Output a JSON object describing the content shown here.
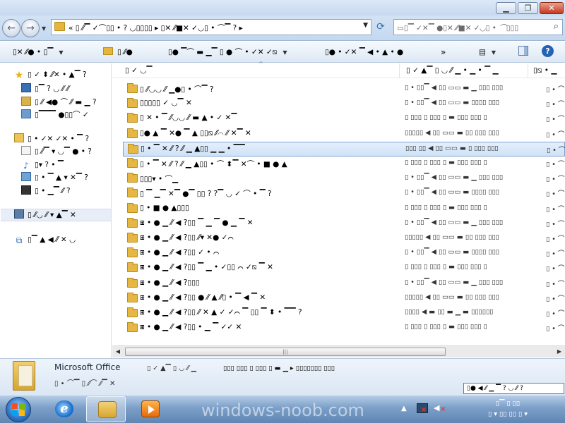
{
  "window": {
    "min_icon": "minimize-icon",
    "max_icon": "maximize-icon",
    "close_icon": "close-icon",
    "min_glyph": "▁",
    "max_glyph": "❐",
    "close_glyph": "✕"
  },
  "address": {
    "path": "« ▯ ⁄⁄▔ ✓⌒▯▯ • ? ◡▯▯▯▯ ▸ ▯✕ ⁄⁄■✕ ✓◡▯ • ⌒▔ ?  ▸",
    "dropdown_glyph": "▼",
    "refresh_glyph": "⟳"
  },
  "search": {
    "placeholder": "▭▯▔ ✓✕▔ ●▯✕ ⁄⁄■✕ ✓◡▯ • ⌒▯▯▯"
  },
  "commands": {
    "organize": "▯✕ ⁄⁄● • ▯▔",
    "include": "▯ ⁄⁄●",
    "share": "▯● ▔⌒ ▬ ▁▔ ▯ ● ⌒ • ✓✕ ✓⧅",
    "burn": "▯● • ✓✕ ▔ ◀ • ▲ • ●",
    "more": "»",
    "views_glyph": "▤",
    "help_glyph": "?"
  },
  "nav": {
    "items": [
      {
        "label": "▯ ✓ ⬍ ⁄⁄✕ • ▲▔ ?",
        "icon": "favorites-star-icon"
      },
      {
        "label": "▯▔ ? ◡ ⁄⁄ ⁄⁄",
        "icon": "desktop-icon"
      },
      {
        "label": "▯ ⁄⁄ ◀● ⌒ ⁄⁄ ▬ ▁ ?",
        "icon": "downloads-icon"
      },
      {
        "label": "▯▔▔▔ ●▯▯⌒ ✓",
        "icon": "recent-places-icon"
      },
      {
        "label": "▯ • ✓✕ ✓✕ • ▔ ?",
        "icon": "libraries-icon"
      },
      {
        "label": "▯ ⁄⁄▔ ▾ ◡▔ ● • ?",
        "icon": "documents-icon"
      },
      {
        "label": "▯▾ ? • ▔",
        "icon": "music-icon"
      },
      {
        "label": "▯ • ▔ ▲ ▾ ✕▔ ?",
        "icon": "pictures-icon"
      },
      {
        "label": "▯ • ▁▔ ⁄⁄ ?",
        "icon": "videos-icon"
      },
      {
        "label": "▯ ⁄⁄◡ ⁄⁄ ▾ ▲▔ ✕",
        "icon": "computer-icon"
      },
      {
        "label": "▯▔ ▲ ◀ ⁄⁄ ✕ ◡",
        "icon": "network-icon"
      }
    ]
  },
  "columns": {
    "name": "▯ ✓ ◡▔",
    "date": "▯ ✓ ▲▔ ▯ ◡ ⁄⁄ ▁ • ▁ • ▔ ▁",
    "type": "▯⧅ • ▁",
    "sort_glyph": "^"
  },
  "files": [
    {
      "name": "▯ ⁄⁄◡◡ ⁄⁄ ▁●▯ • ⌒▔ ?",
      "date": "▯ • ▯▯▔ ◀ ▯▯ ▭▭ ▬ ▁ ▯▯▯ ▯▯▯",
      "type": "▯ • ⌒ ▯▯▯"
    },
    {
      "name": "▯▯▯▯▯ ✓ ◡▔ ✕",
      "date": "▯ • ▯▯▔ ◀ ▯▯ ▭▭ ▬ ▯▯▯▯ ▯▯▯",
      "type": "▯ • ⌒ ▯▯▯"
    },
    {
      "name": "▯ ✕ • ▔ ⁄⁄◡◡ ⁄⁄ ▬ ▲ • ✓ ✕▔",
      "date": "▯ ▯▯▯ ▯ ▯▯▯ ▯ ▬ ▯▯▯ ▯▯▯ ▯",
      "type": "▯ • ⌒ ▯▯▯"
    },
    {
      "name": "▯● ▲ ▔ ✕● ▔ ▲ ▯▯⧅ ⁄⁄⌒ ⁄⁄ ✕▔ ✕",
      "date": "▯▯▯▯▯ ◀ ▯▯ ▭▭ ▬ ▯▯ ▯▯▯ ▯▯▯",
      "type": "▯ • ⌒ ▯▯▯"
    },
    {
      "name": "▯ • ▔ ✕ ⁄⁄ ? ⁄⁄ ▁ ▲▯▯ ▁ ▁ • ▔▔",
      "date": "▯▯▯ ▯▯ ◀ ▯▯ ▭▭ ▬ ▯ ▯▯▯ ▯▯▯",
      "type": "▯ • ⌒ ▯▯▯",
      "selected": true
    },
    {
      "name": "▯ • ▔ ✕ ⁄⁄ ? ⁄⁄ ▁ ▲▯▯ • ⌒ ⬍▔ ✕⌒ • ■ ● ▲",
      "date": "▯ ▯▯▯ ▯ ▯▯▯ ▯ ▬ ▯▯▯ ▯▯▯ ▯",
      "type": "▯ • ⌒ ▯▯▯"
    },
    {
      "name": "▯▯▯▾ • ⌒▁",
      "date": "▯ • ▯▯▔ ◀ ▯▯ ▭▭ ▬ ▁ ▯▯▯ ▯▯▯",
      "type": "▯ • ⌒ ▯▯▯"
    },
    {
      "name": "▯ ▔ ▁▔ ✕▔ ●▔ ▯▯ ? ?▔ ◡ ✓ ⌒ • ▔ ?",
      "date": "▯ • ▯▯▔ ◀ ▯▯ ▭▭ ▬ ▯▯▯▯ ▯▯▯",
      "type": "▯ • ⌒ ▯▯▯"
    },
    {
      "name": "▯ • ■ ● ▲▯▯▯",
      "date": "▯ ▯▯▯ ▯ ▯▯▯ ▯ ▬ ▯▯▯ ▯▯▯ ▯",
      "type": "▯ • ⌒ ▯▯▯"
    },
    {
      "name": "⧆ • ● ▁ ⁄⁄ ◀ ?▯▯ ▔ ▁ ▔ ● ▁ ▔ ✕",
      "date": "▯ • ▯▯▔ ◀ ▯▯ ▭▭ ▬ ▁ ▯▯▯ ▯▯▯",
      "type": "▯ • ⌒ ▯▯▯"
    },
    {
      "name": "⧆ • ● ▁ ⁄⁄ ◀ ?▯▯ ⁄⁄▾ ✕● ✓⌒",
      "date": "▯▯▯▯▯ ◀ ▯▯ ▭▭ ▬ ▯▯ ▯▯▯ ▯▯▯",
      "type": "▯ • ⌒ ▯▯▯"
    },
    {
      "name": "⧆ • ● ▁ ⁄⁄ ◀ ?▯▯ ✓ • ⌒",
      "date": "▯ • ▯▯▔ ◀ ▯▯ ▭▭ ▬ ▯▯▯▯ ▯▯▯",
      "type": "▯ • ⌒ ▯▯▯"
    },
    {
      "name": "⧆ • ● ▁ ⁄⁄ ◀ ?▯▯ ▔ ▁ • ✓▯▯ ⌒ ✓⧅ ▔ ✕",
      "date": "▯ ▯▯▯ ▯ ▯▯▯ ▯ ▬ ▯▯▯ ▯▯▯ ▯",
      "type": "▯ • ⌒ ▯▯▯"
    },
    {
      "name": "⧆ • ● ▁ ⁄⁄ ◀ ?▯▯▯",
      "date": "▯ • ▯▯▔ ◀ ▯▯ ▭▭ ▬ ▁ ▯▯▯ ▯▯▯",
      "type": "▯ • ⌒ ▯▯▯"
    },
    {
      "name": "⧆ • ● ▁ ⁄⁄ ◀ ?▯▯ ● ⁄⁄ ▲ ⁄⁄▯ • ▔ ◀ ▔ ✕",
      "date": "▯▯▯▯▯ ◀ ▯▯ ▭▭ ▬ ▯▯ ▯▯▯ ▯▯▯",
      "type": "▯ • ⌒ ▯▯▯"
    },
    {
      "name": "⧆ • ● ▁ ⁄⁄ ◀ ?▯▯ ⁄⁄ ✕ ▲ ✓ ✓⌒ ▔ ▯▯ ▔ ⬍ • ▔▔ ?",
      "date": "▯▯▯▯ ◀ ▬ ▯▯ ▬ ▁ ▬ ▯▯▯▯▯▯",
      "type": "▯ • ⌒ ▯▯▯"
    },
    {
      "name": "⧆ • ● ▁ ⁄⁄ ◀ ?▯▯ • ▁ ▔ ✓✓ ✕",
      "date": "▯ ▯▯▯ ▯ ▯▯▯ ▯ ▬ ▯▯▯ ▯▯▯ ▯",
      "type": "▯ • ⌒ ▯▯▯"
    }
  ],
  "scrollbar": {
    "left_glyph": "◀",
    "right_glyph": "▶",
    "grip": "|||"
  },
  "details": {
    "name": "Microsoft Office",
    "type": "▯ • ⌒▔ ▯ ⁄⁄⌒ ⁄⁄▔ ✕",
    "modified_label": "▯ ✓ ▲▔ ▯ ◡ ⁄⁄ ▁",
    "modified_value": "▯▯▯ ▯▯▯ ▯ ▯▯▯ ▯ ▬ ▁ ▸ ▯▯▯▯▯▯▯ ▯▯▯"
  },
  "tooltip": "▯● ◀ ⁄⁄ ▁ ▔ ? ◡ ⁄⁄ ?",
  "taskbar": {
    "watermark": "windows-noob.com",
    "tray_arrow": "▲",
    "clock_time": "▯▔ ▯ ▯▯",
    "clock_date": "▯ ▾ ▯▯ ▯▯ ▯ ▾"
  }
}
